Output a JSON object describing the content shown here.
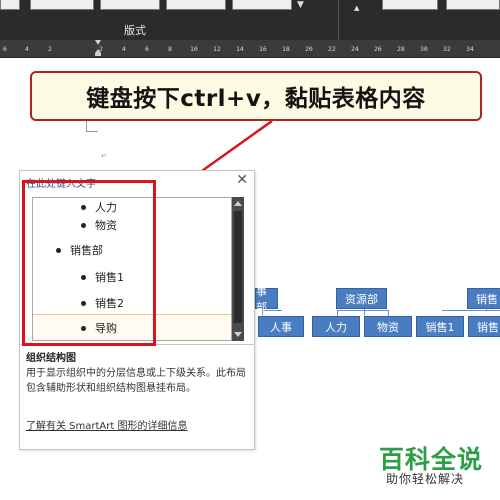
{
  "ribbon": {
    "group_label": "版式"
  },
  "ruler": {
    "ticks": [
      "6",
      "4",
      "2",
      "2",
      "4",
      "6",
      "8",
      "10",
      "12",
      "14",
      "16",
      "18",
      "20",
      "22",
      "24",
      "26",
      "28",
      "30",
      "32",
      "34"
    ]
  },
  "callout": {
    "text": "键盘按下ctrl+v，黏贴表格内容"
  },
  "text_pane": {
    "title": "在此处键入文字",
    "close_icon": "close-icon",
    "items": [
      {
        "label": "人力",
        "level": 2
      },
      {
        "label": "物资",
        "level": 2
      },
      {
        "label": "销售部",
        "level": 1
      },
      {
        "label": "销售1",
        "level": 2
      },
      {
        "label": "销售2",
        "level": 2
      },
      {
        "label": "导购",
        "level": 2
      }
    ],
    "description_title": "组织结构图",
    "description": "用于显示组织中的分层信息或上下级关系。此布局包含辅助形状和组织结构图悬挂布局。",
    "link": "了解有关 SmartArt 图形的详细信息"
  },
  "org_chart": {
    "dept_partial_left": "事部",
    "dept_resources": "资源部",
    "dept_sales": "销售",
    "child_hr": "人事",
    "child_manpower": "人力",
    "child_materials": "物资",
    "child_sales1": "销售1",
    "child_sales_partial": "销售",
    "node_color": "#4a7cc2"
  },
  "watermark": {
    "title": "百科全说",
    "subtitle": "助你轻松解决"
  },
  "colors": {
    "highlight": "#d8141c",
    "callout_border": "#b02424",
    "watermark": "#2c9e45"
  }
}
